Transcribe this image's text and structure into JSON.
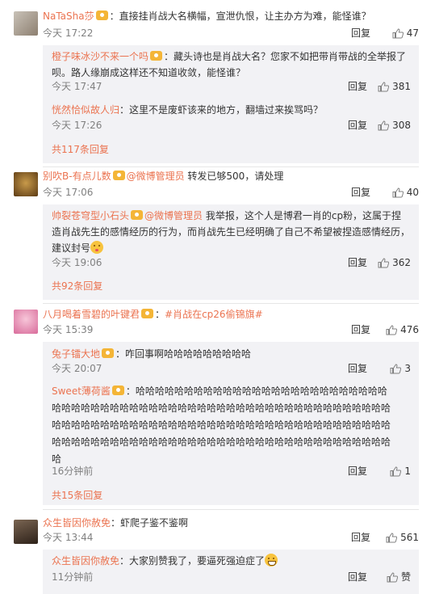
{
  "labels": {
    "reply": "回复"
  },
  "comments": [
    {
      "user": "NaTaSha莎",
      "text": "：直接挂肖战大名横幅，宣泄仇恨，让主办方为难，能怪谁？",
      "time": "今天 17:22",
      "likes": "47",
      "replies": [
        {
          "user": "橙子味冰沙不来一个吗",
          "text_line1": "：藏头诗也是肖战大名？您家不如把带肖带战的全举报了",
          "text_line2": "呗。路人缘崩成这样还不知道收敛，能怪谁？",
          "time": "今天 17:47",
          "likes": "381"
        },
        {
          "user": "恍然恰似故人归",
          "text": "：这里不是废虾该来的地方，翻墙过来挨骂吗？",
          "time": "今天 17:26",
          "likes": "308"
        }
      ],
      "more": "共117条回复"
    },
    {
      "user": "别吹B-有点儿数",
      "mention": "@微博管理员",
      "text": " 转发已够500，请处理",
      "time": "今天 17:06",
      "likes": "40",
      "replies": [
        {
          "user": "帅裂苍穹型小石头",
          "mention": "@微博管理员",
          "text_line1": " 我举报，这个人是博君一肖的cp粉，这属于捏",
          "text_line2": "造肖战先生的感情经历的行为，而肖战先生已经明确了自己不希望被捏造感情经历，",
          "text_line3": "建议封号",
          "time": "今天 19:06",
          "likes": "362"
        }
      ],
      "more": "共92条回复"
    },
    {
      "user": "八月喝着雪碧的叶键君",
      "mention": "#肖战在cp26偷锦旗#",
      "time": "今天 15:39",
      "likes": "476",
      "replies": [
        {
          "user": "兔子镭大地",
          "text": "：咋回事啊哈哈哈哈哈哈哈哈哈",
          "time": "今天 20:07",
          "likes": "3"
        },
        {
          "user": "Sweet薄荷酱",
          "text_line1": "：哈哈哈哈哈哈哈哈哈哈哈哈哈哈哈哈哈哈哈哈哈哈哈哈哈哈",
          "text_line2": "哈哈哈哈哈哈哈哈哈哈哈哈哈哈哈哈哈哈哈哈哈哈哈哈哈哈哈哈哈哈哈哈哈哈哈",
          "text_line3": "哈哈哈哈哈哈哈哈哈哈哈哈哈哈哈哈哈哈哈哈哈哈哈哈哈哈哈哈哈哈哈哈哈哈哈",
          "text_line4": "哈哈哈哈哈哈哈哈哈哈哈哈哈哈哈哈哈哈哈哈哈哈哈哈哈哈哈哈哈哈哈哈哈哈哈",
          "text_line5": "哈",
          "time": "16分钟前",
          "likes": "1"
        }
      ],
      "more": "共15条回复"
    },
    {
      "user": "众生皆因你赦免",
      "text": "：虾爬子鉴不鉴啊",
      "time": "今天 13:44",
      "likes": "561",
      "replies": [
        {
          "user": "众生皆因你赦免",
          "text": "：大家别赞我了，要逼死强迫症了",
          "time": "11分钟前",
          "likes": "赞"
        }
      ]
    }
  ],
  "icons": {
    "thumb": "thumbs-up-icon",
    "badge": "member-badge-icon"
  },
  "colors": {
    "username": "#eb7350",
    "reply_bg": "#f2f2f5",
    "meta": "#808080"
  }
}
